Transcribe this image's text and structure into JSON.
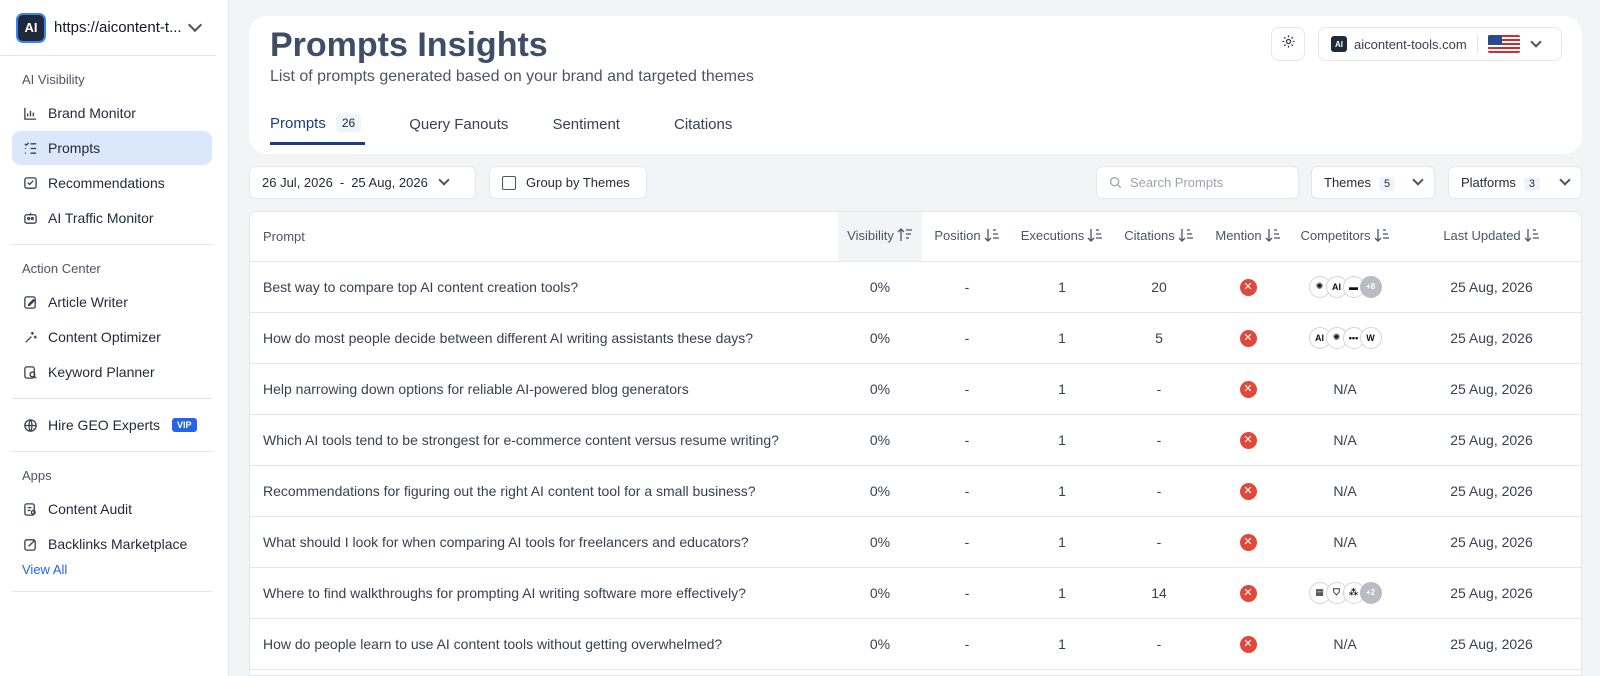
{
  "sidebar": {
    "brand_url": "https://aicontent-t...",
    "brand_logo_text": "AI",
    "sections": {
      "ai_visibility": "AI Visibility",
      "action_center": "Action Center",
      "apps": "Apps"
    },
    "items": {
      "brand_monitor": "Brand Monitor",
      "prompts": "Prompts",
      "recommendations": "Recommendations",
      "ai_traffic_monitor": "AI Traffic Monitor",
      "article_writer": "Article Writer",
      "content_optimizer": "Content Optimizer",
      "keyword_planner": "Keyword Planner",
      "hire_geo_experts": "Hire GEO Experts",
      "vip_badge": "VIP",
      "content_audit": "Content Audit",
      "backlinks_marketplace": "Backlinks Marketplace",
      "view_all": "View All"
    }
  },
  "header": {
    "title": "Prompts Insights",
    "subtitle": "List of prompts generated based on your brand and targeted themes",
    "site_name": "aicontent-tools.com",
    "site_logo_text": "AI"
  },
  "tabs": {
    "prompts": "Prompts",
    "prompts_count": "26",
    "query_fanouts": "Query Fanouts",
    "sentiment": "Sentiment",
    "citations": "Citations"
  },
  "toolbar": {
    "date_start": "26 Jul, 2026",
    "date_sep": "-",
    "date_end": "25 Aug, 2026",
    "group_by": "Group by Themes",
    "search_placeholder": "Search Prompts",
    "themes": "Themes",
    "themes_count": "5",
    "platforms": "Platforms",
    "platforms_count": "3"
  },
  "table": {
    "headers": {
      "prompt": "Prompt",
      "visibility": "Visibility",
      "position": "Position",
      "executions": "Executions",
      "citations": "Citations",
      "mention": "Mention",
      "competitors": "Competitors",
      "last_updated": "Last Updated"
    },
    "rows": [
      {
        "prompt": "Best way to compare top AI content creation tools?",
        "visibility": "0%",
        "position": "-",
        "executions": "1",
        "citations": "20",
        "competitors": [
          "✺",
          "AI",
          "▬"
        ],
        "more": "+8",
        "na": "",
        "updated": "25 Aug, 2026"
      },
      {
        "prompt": "How do most people decide between different AI writing assistants these days?",
        "visibility": "0%",
        "position": "-",
        "executions": "1",
        "citations": "5",
        "competitors": [
          "AI",
          "✺",
          "•••",
          "W"
        ],
        "more": "",
        "na": "",
        "updated": "25 Aug, 2026"
      },
      {
        "prompt": "Help narrowing down options for reliable AI-powered blog generators",
        "visibility": "0%",
        "position": "-",
        "executions": "1",
        "citations": "-",
        "competitors": [],
        "more": "",
        "na": "N/A",
        "updated": "25 Aug, 2026"
      },
      {
        "prompt": "Which AI tools tend to be strongest for e-commerce content versus resume writing?",
        "visibility": "0%",
        "position": "-",
        "executions": "1",
        "citations": "-",
        "competitors": [],
        "more": "",
        "na": "N/A",
        "updated": "25 Aug, 2026"
      },
      {
        "prompt": "Recommendations for figuring out the right AI content tool for a small business?",
        "visibility": "0%",
        "position": "-",
        "executions": "1",
        "citations": "-",
        "competitors": [],
        "more": "",
        "na": "N/A",
        "updated": "25 Aug, 2026"
      },
      {
        "prompt": "What should I look for when comparing AI tools for freelancers and educators?",
        "visibility": "0%",
        "position": "-",
        "executions": "1",
        "citations": "-",
        "competitors": [],
        "more": "",
        "na": "N/A",
        "updated": "25 Aug, 2026"
      },
      {
        "prompt": "Where to find walkthroughs for prompting AI writing software more effectively?",
        "visibility": "0%",
        "position": "-",
        "executions": "1",
        "citations": "14",
        "competitors": [
          "▦",
          "⛉",
          "⁂"
        ],
        "more": "+2",
        "na": "",
        "updated": "25 Aug, 2026"
      },
      {
        "prompt": "How do people learn to use AI content tools without getting overwhelmed?",
        "visibility": "0%",
        "position": "-",
        "executions": "1",
        "citations": "-",
        "competitors": [],
        "more": "",
        "na": "N/A",
        "updated": "25 Aug, 2026"
      }
    ]
  },
  "colors": {
    "accent": "#1e3a8a",
    "active_nav": "#dbe7fb",
    "mention_no": "#e0483a"
  }
}
